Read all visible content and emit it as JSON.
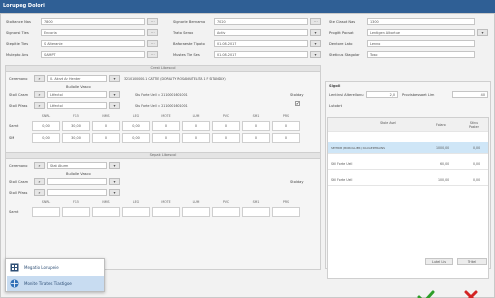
{
  "window": {
    "title": "Lorupeg Dolori"
  },
  "header": {
    "left": [
      {
        "label": "Stoltance Nas",
        "value": "7800"
      },
      {
        "label": "Signorsi Ties",
        "value": "Encoria"
      },
      {
        "label": "Stepitie Ties",
        "value": "S Alteranie"
      },
      {
        "label": "Mulepto Ans",
        "value": "SAMPT"
      }
    ],
    "mid": [
      {
        "label": "Signorle Bernamo",
        "value": "7020"
      },
      {
        "label": "Trato Serox",
        "value": "Activ"
      },
      {
        "label": "Baforaeste Tipoto",
        "value": "01.08.2017"
      },
      {
        "label": "Mustes Tie Ses",
        "value": "01.08.2017"
      }
    ],
    "right": [
      {
        "label": "Ste Clasot Nas",
        "value": "1300"
      },
      {
        "label": "Progitt Pocsat",
        "value": "Lentigen Alkortue"
      },
      {
        "label": "Dentore Lato",
        "value": "Lenno"
      },
      {
        "label": "Steticus Stagolar",
        "value": "Toso"
      }
    ]
  },
  "upper_section": {
    "title": "Crest Libescol",
    "row1_label": "Ceremono",
    "row1_value": "0. Akrzt Ar Henter",
    "row1_text": "3210100000.1 CATTIE (DORILITY ROSANIUTELITA 1 F SITANDLY)",
    "sub_label": "Bullolle Vasco",
    "row2_label": "Stoll Casm",
    "row2_value": "Ltfectol",
    "row2_note": "Stu Forte Uell = 2110001601001",
    "row3_label": "Stoll Pfass",
    "row3_value": "Ltfectol",
    "row3_note": "Stu Forte Uell = 2110001601001",
    "checkbox_label": "Stolday",
    "checkbox_mark": "✔",
    "col_heads": [
      "SNRL",
      "F15",
      "NMS",
      "LEG",
      "MOTE",
      "LUM",
      "PVC",
      "SM1",
      "PRS"
    ],
    "row_heads": [
      "Samt",
      "SM"
    ],
    "values": [
      [
        "0,00",
        "30,00",
        "0",
        "0,00",
        "0",
        "0",
        "0",
        "0",
        "0"
      ],
      [
        "0,00",
        "30,00",
        "0",
        "0,00",
        "0",
        "0",
        "0",
        "0",
        "0"
      ]
    ]
  },
  "lower_section": {
    "title": "Sepak Libescol",
    "row1_label": "Ceremono",
    "row1_value": "Stat Aturm",
    "sub_label": "Bullolle Vasco",
    "row2_label": "Stoll Casm",
    "row3_label": "Stoll Pfass",
    "checkbox_label": "Stolday",
    "col_heads": [
      "SNRL",
      "F15",
      "NMS",
      "LEG",
      "MOTE",
      "LUM",
      "PVC",
      "SM1",
      "PRS"
    ],
    "row_head": "Samt"
  },
  "right_panel": {
    "title": "Sigoli",
    "label_a": "Lentinsi Alterellonu",
    "value_a": "2,0",
    "label_b": "Provisbessaet Lim",
    "value_b": "40",
    "sub_title": "Lutobrt",
    "col_heads": [
      "Stole Asel",
      "Folaro",
      "Stinu Poster"
    ],
    "rows": [
      [
        "SEITRIB (BOROLLIER) DAUAERTRAINS",
        "1000,00",
        "0,00"
      ],
      [
        "Stll Forte Uell",
        "60,00",
        "0,00"
      ],
      [
        "Stll Forte Uell",
        "100,00",
        "0,00"
      ]
    ],
    "foot_a": "Lutel Lis",
    "foot_b": "Tritel"
  },
  "context_menu": {
    "items": [
      {
        "label": "Megatio Lorupeie",
        "icon": "grid-icon"
      },
      {
        "label": "Monite Tirates Tiastigoe",
        "icon": "globe-icon"
      }
    ]
  },
  "actions": {
    "ok": "check-icon",
    "cancel": "close-icon"
  },
  "colors": {
    "titlebar": "#2f5f95",
    "ok": "#2e9e2a",
    "cancel": "#d32424",
    "selection": "#cfe6f7"
  }
}
